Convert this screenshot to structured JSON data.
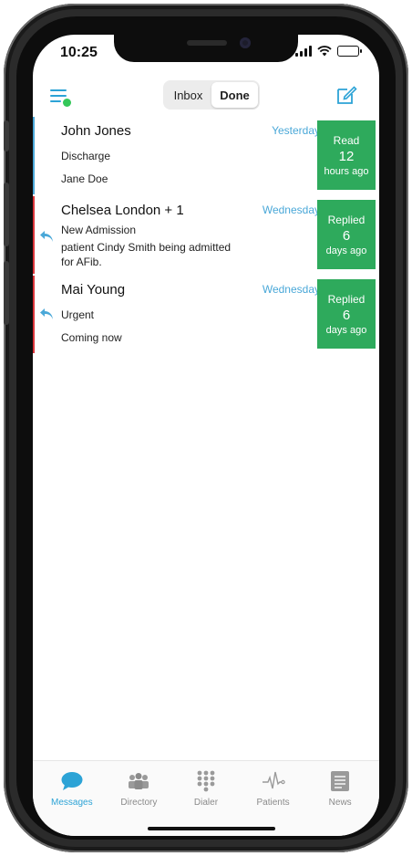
{
  "status_bar": {
    "time": "10:25"
  },
  "nav": {
    "segments": [
      {
        "label": "Inbox",
        "active": false
      },
      {
        "label": "Done",
        "active": true
      }
    ]
  },
  "messages": [
    {
      "name": "John Jones",
      "line1": "Discharge",
      "line2": "Jane Doe",
      "line3": "",
      "when": "Yesterday",
      "replied": false,
      "bar_color": "#4aa8d8",
      "status": {
        "label": "Read",
        "num": "12",
        "unit": "hours ago"
      }
    },
    {
      "name": "Chelsea London + 1",
      "line1": "New Admission",
      "line2": "patient Cindy Smith being admitted",
      "line3": "for AFib.",
      "when": "Wednesday",
      "replied": true,
      "bar_color": "#d9343a",
      "status": {
        "label": "Replied",
        "num": "6",
        "unit": "days ago"
      }
    },
    {
      "name": "Mai Young",
      "line1": "Urgent",
      "line2": "Coming now",
      "line3": "",
      "when": "Wednesday",
      "replied": true,
      "bar_color": "#d9343a",
      "status": {
        "label": "Replied",
        "num": "6",
        "unit": "days ago"
      }
    }
  ],
  "tabs": [
    {
      "label": "Messages",
      "icon": "chat-bubble-icon",
      "active": true
    },
    {
      "label": "Directory",
      "icon": "people-icon",
      "active": false
    },
    {
      "label": "Dialer",
      "icon": "keypad-icon",
      "active": false
    },
    {
      "label": "Patients",
      "icon": "heartbeat-icon",
      "active": false
    },
    {
      "label": "News",
      "icon": "newspaper-icon",
      "active": false
    }
  ],
  "colors": {
    "accent": "#2ca3d6",
    "status_green": "#2eaa5c",
    "online_dot": "#34c759"
  }
}
